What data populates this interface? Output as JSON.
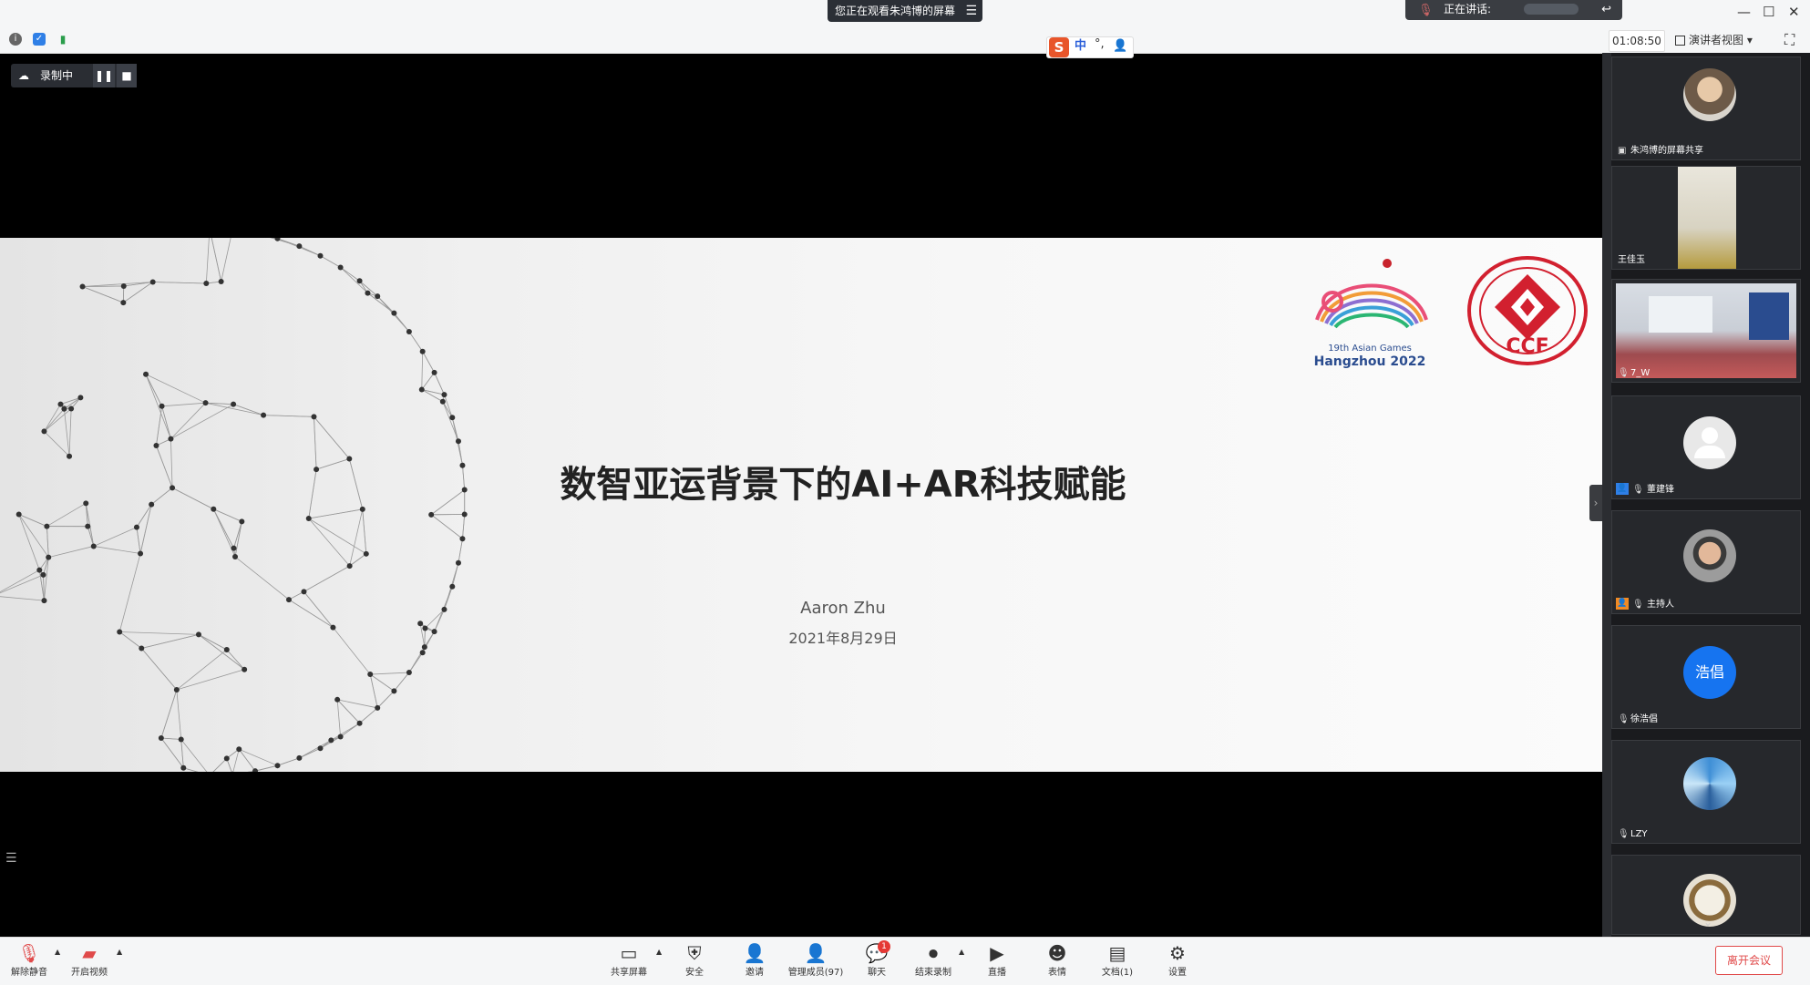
{
  "share_banner": {
    "text": "您正在观看朱鸿博的屏幕",
    "menu_icon": "menu-icon"
  },
  "speaking": {
    "label": "正在讲话:"
  },
  "window_controls": {
    "minimize": "—",
    "maximize": "☐",
    "close": "✕"
  },
  "toolbar": {
    "timer": "01:08:50",
    "view_mode": "演讲者视图"
  },
  "ime": {
    "logo": "S",
    "mode": "中",
    "punct": "°,"
  },
  "recording": {
    "label": "录制中"
  },
  "slide": {
    "title": "数智亚运背景下的AI+AR科技赋能",
    "author": "Aaron Zhu",
    "date": "2021年8月29日",
    "asian_games_line1": "19th Asian Games",
    "asian_games_line2": "Hangzhou 2022"
  },
  "participants": [
    {
      "name": "朱鸿博的屏幕共享",
      "kind": "screen-share"
    },
    {
      "name": "王佳玉",
      "kind": "video"
    },
    {
      "name": "7_W",
      "kind": "video"
    },
    {
      "name": "董建锋",
      "kind": "placeholder"
    },
    {
      "name": "主持人",
      "kind": "photo"
    },
    {
      "name": "徐浩倡",
      "kind": "initials",
      "initials": "浩倡"
    },
    {
      "name": "LZY",
      "kind": "photo"
    },
    {
      "name": "",
      "kind": "photo"
    }
  ],
  "bottom_toolbar": {
    "unmute": "解除静音",
    "start_video": "开启视频",
    "share_screen": "共享屏幕",
    "security": "安全",
    "invite": "邀请",
    "manage_members": "管理成员(97)",
    "chat": "聊天",
    "chat_badge": "1",
    "end_recording": "结束录制",
    "live": "直播",
    "reactions": "表情",
    "docs": "文档(1)",
    "settings": "设置",
    "leave": "离开会议"
  },
  "colors": {
    "accent_blue": "#2f7fe6",
    "leave_red": "#e04a4a",
    "dark_panel": "#1a1b1e"
  }
}
